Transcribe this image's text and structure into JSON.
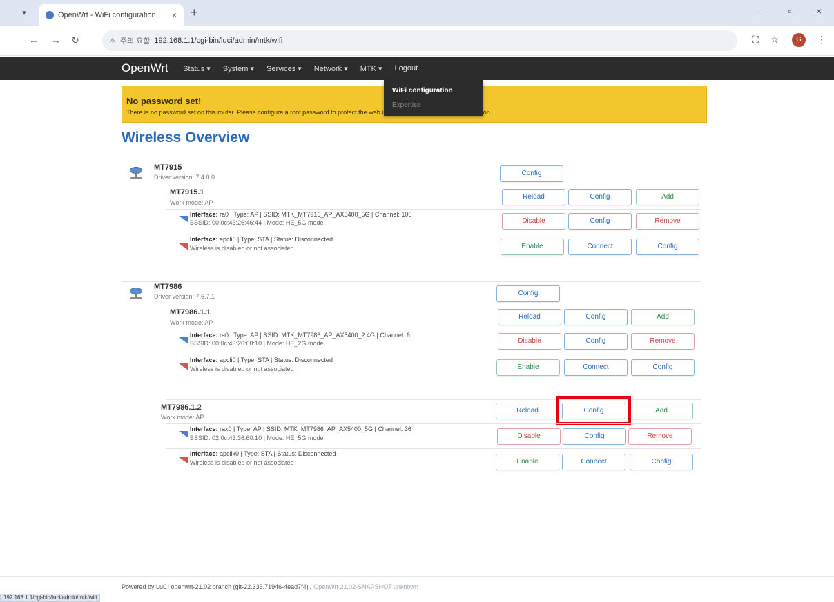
{
  "browser": {
    "tab_title": "OpenWrt - WiFi configuration",
    "tab_close": "×",
    "new_tab": "+",
    "window_controls": {
      "minimize": "–",
      "maximize": "▫",
      "close": "×"
    },
    "nav": {
      "back": "←",
      "forward": "→",
      "reload": "↻"
    },
    "address_warning": "⚠",
    "address_security": "주의 요함",
    "url": "192.168.1.1/cgi-bin/luci/admin/mtk/wifi",
    "profile_initial": "G",
    "status_bar_url": "192.168.1.1/cgi-bin/luci/admin/mtk/wifi"
  },
  "header": {
    "brand": "OpenWrt",
    "menu": [
      "Status ▾",
      "System ▾",
      "Services ▾",
      "Network ▾",
      "MTK ▾",
      "Logout"
    ],
    "dropdown": {
      "active": "WiFi configuration",
      "other": "Expertise"
    }
  },
  "alert": {
    "title": "No password set!",
    "text": "There is no password set on this router. Please configure a root password to protect the web interface. Go to password configuration..."
  },
  "page_title": "Wireless Overview",
  "devices": [
    {
      "name": "MT7915",
      "driver": "Driver version: 7.4.0.0",
      "config_label": "Config",
      "band": {
        "name": "MT7915.1",
        "mode": "Work mode: AP",
        "buttons": [
          "Reload",
          "Config",
          "Add"
        ],
        "ifaces": [
          {
            "line1_label": "Interface:",
            "line1_rest": " ra0 | Type: AP | SSID: MTK_MT7915_AP_AX5400_5G | Channel: 100",
            "line2": "BSSID: 00:0c:43:26:46:44 | Mode: HE_5G mode",
            "buttons": [
              "Disable",
              "Config",
              "Remove"
            ]
          },
          {
            "line1_label": "Interface:",
            "line1_rest": " apcli0 | Type: STA | Status: Disconnected",
            "line2": "Wireless is disabled or not associated",
            "buttons": [
              "Enable",
              "Connect",
              "Config"
            ]
          }
        ]
      }
    },
    {
      "name": "MT7986",
      "driver": "Driver version: 7.6.7.1",
      "config_label": "Config",
      "band": {
        "name": "MT7986.1.1",
        "mode": "Work mode: AP",
        "buttons": [
          "Reload",
          "Config",
          "Add"
        ],
        "ifaces": [
          {
            "line1_label": "Interface:",
            "line1_rest": " ra0 | Type: AP | SSID: MTK_MT7986_AP_AX5400_2.4G | Channel: 6",
            "line2": "BSSID: 00:0c:43:26:60:10 | Mode: HE_2G mode",
            "buttons": [
              "Disable",
              "Config",
              "Remove"
            ]
          },
          {
            "line1_label": "Interface:",
            "line1_rest": " apcli0 | Type: STA | Status: Disconnected",
            "line2": "Wireless is disabled or not associated",
            "buttons": [
              "Enable",
              "Connect",
              "Config"
            ]
          }
        ]
      },
      "band2": {
        "name": "MT7986.1.2",
        "mode": "Work mode: AP",
        "buttons": [
          "Reload",
          "Config",
          "Add"
        ],
        "ifaces": [
          {
            "line1_label": "Interface:",
            "line1_rest": " rax0 | Type: AP | SSID: MTK_MT7986_AP_AX5400_5G | Channel: 36",
            "line2": "BSSID: 02:0c:43:36:60:10 | Mode: HE_5G mode",
            "buttons": [
              "Disable",
              "Config",
              "Remove"
            ]
          },
          {
            "line1_label": "Interface:",
            "line1_rest": " apclix0 | Type: STA | Status: Disconnected",
            "line2": "Wireless is disabled or not associated",
            "buttons": [
              "Enable",
              "Connect",
              "Config"
            ]
          }
        ]
      }
    }
  ],
  "footer": {
    "main": "Powered by LuCI openwrt-21.02 branch (git-22.335.71946-4ead7f4) / ",
    "light": "OpenWrt 21.02-SNAPSHOT unknown"
  },
  "colors": {
    "accent": "#2a6ab8",
    "header_bg": "#2c2c2c",
    "alert_bg": "#f3c62e",
    "highlight": "#e60012"
  }
}
